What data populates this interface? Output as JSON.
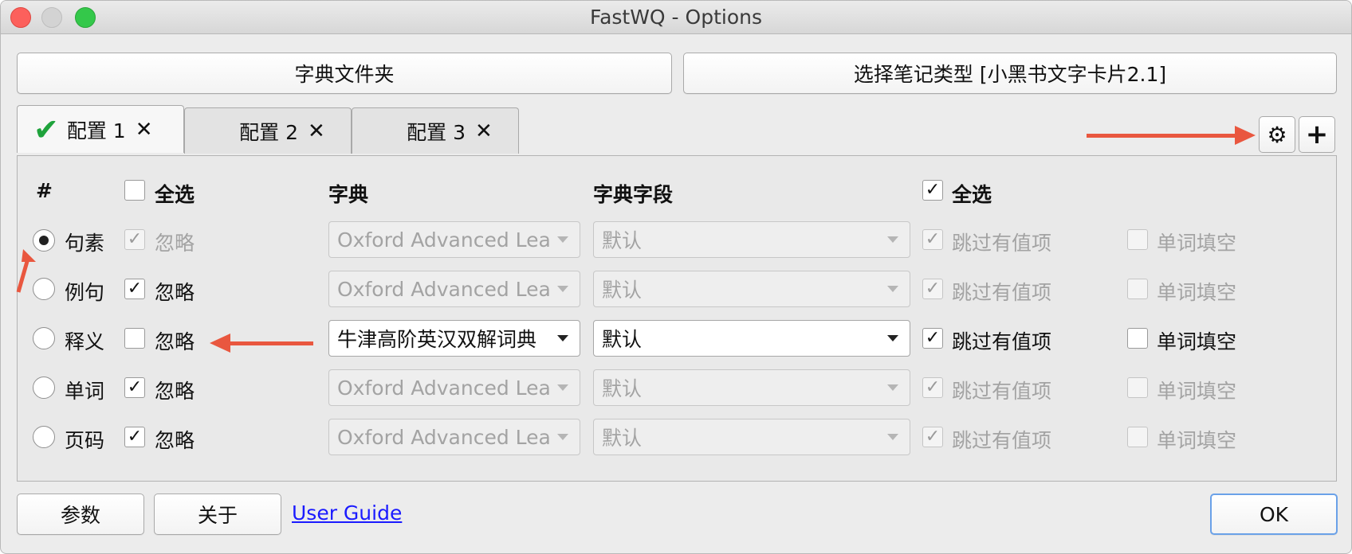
{
  "window": {
    "title": "FastWQ - Options"
  },
  "top_buttons": {
    "dict_folder": "字典文件夹",
    "select_note_type": "选择笔记类型 [小黑书文字卡片2.1]"
  },
  "tabs": [
    {
      "label": "配置 1",
      "active": true
    },
    {
      "label": "配置 2",
      "active": false
    },
    {
      "label": "配置 3",
      "active": false
    }
  ],
  "tab_actions": {
    "settings_icon": "gear-icon",
    "add_icon": "plus-icon"
  },
  "headers": {
    "hash": "#",
    "select_all_left": "全选",
    "dictionary": "字典",
    "dict_field": "字典字段",
    "select_all_right": "全选"
  },
  "rows": [
    {
      "field": "句素",
      "selected": true,
      "ignore": "忽略",
      "ignore_checked": true,
      "enabled": false,
      "dictionary": "Oxford Advanced Learr",
      "dict_field": "默认",
      "skip": "跳过有值项",
      "skip_checked": true,
      "cloze": "单词填空",
      "cloze_checked": false
    },
    {
      "field": "例句",
      "selected": false,
      "ignore": "忽略",
      "ignore_checked": true,
      "enabled": false,
      "dictionary": "Oxford Advanced Learr",
      "dict_field": "默认",
      "skip": "跳过有值项",
      "skip_checked": true,
      "cloze": "单词填空",
      "cloze_checked": false
    },
    {
      "field": "释义",
      "selected": false,
      "ignore": "忽略",
      "ignore_checked": false,
      "enabled": true,
      "dictionary": "牛津高阶英汉双解词典",
      "dict_field": "默认",
      "skip": "跳过有值项",
      "skip_checked": true,
      "cloze": "单词填空",
      "cloze_checked": false
    },
    {
      "field": "单词",
      "selected": false,
      "ignore": "忽略",
      "ignore_checked": true,
      "enabled": false,
      "dictionary": "Oxford Advanced Learr",
      "dict_field": "默认",
      "skip": "跳过有值项",
      "skip_checked": true,
      "cloze": "单词填空",
      "cloze_checked": false
    },
    {
      "field": "页码",
      "selected": false,
      "ignore": "忽略",
      "ignore_checked": true,
      "enabled": false,
      "dictionary": "Oxford Advanced Learr",
      "dict_field": "默认",
      "skip": "跳过有值项",
      "skip_checked": true,
      "cloze": "单词填空",
      "cloze_checked": false
    }
  ],
  "bottom": {
    "params": "参数",
    "about": "关于",
    "user_guide": "User Guide",
    "ok": "OK"
  },
  "colors": {
    "accent_arrow": "#e9573f",
    "check_green": "#1fa33c",
    "link": "#1a1aff"
  }
}
